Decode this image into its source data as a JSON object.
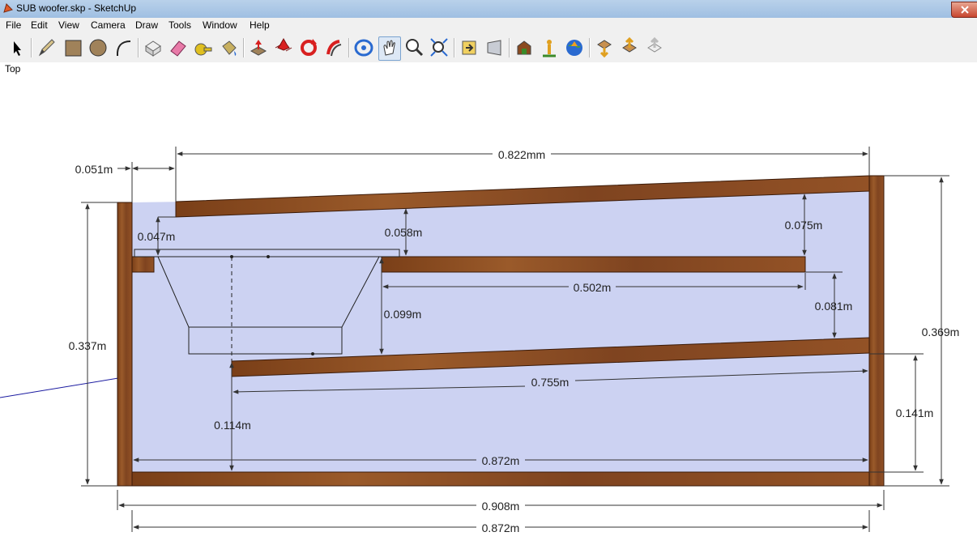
{
  "window": {
    "title": "SUB woofer.skp - SketchUp"
  },
  "menu": [
    "File",
    "Edit",
    "View",
    "Camera",
    "Draw",
    "Tools",
    "Window",
    "Help"
  ],
  "toolbar": {
    "tools": [
      "select-icon",
      "pencil-icon",
      "rectangle-icon",
      "circle-icon",
      "arc-icon",
      "make-component-icon",
      "eraser-icon",
      "tape-measure-icon",
      "paint-bucket-icon",
      "push-pull-icon",
      "move-icon",
      "rotate-icon",
      "follow-me-icon",
      "orbit-icon",
      "pan-icon",
      "zoom-icon",
      "zoom-extents-icon",
      "previous-view-icon",
      "next-view-icon",
      "3d-warehouse-icon",
      "place-model-icon",
      "google-earth-icon",
      "get-models-icon",
      "share-model-icon",
      "share-component-icon"
    ]
  },
  "viewport": {
    "scene_label": "Top"
  },
  "dimensions": {
    "top_width": "0.822mm",
    "left_offset": "0.051m",
    "lip_height": "0.047m",
    "upper_gap": "0.058m",
    "right_gap": "0.075m",
    "shelf_length": "0.502m",
    "middle_gap": "0.081m",
    "driver_depth": "0.099m",
    "ramp_length": "0.755m",
    "ramp_height": "0.114m",
    "right_lower_height": "0.141m",
    "left_height": "0.337m",
    "right_height": "0.369m",
    "inner_width": "0.872m",
    "outer_width": "0.908m",
    "bottom_width": "0.872m"
  },
  "colors": {
    "wood": "#8a4a1f",
    "interior": "#ccd2f2",
    "dimension_line": "#333333"
  }
}
